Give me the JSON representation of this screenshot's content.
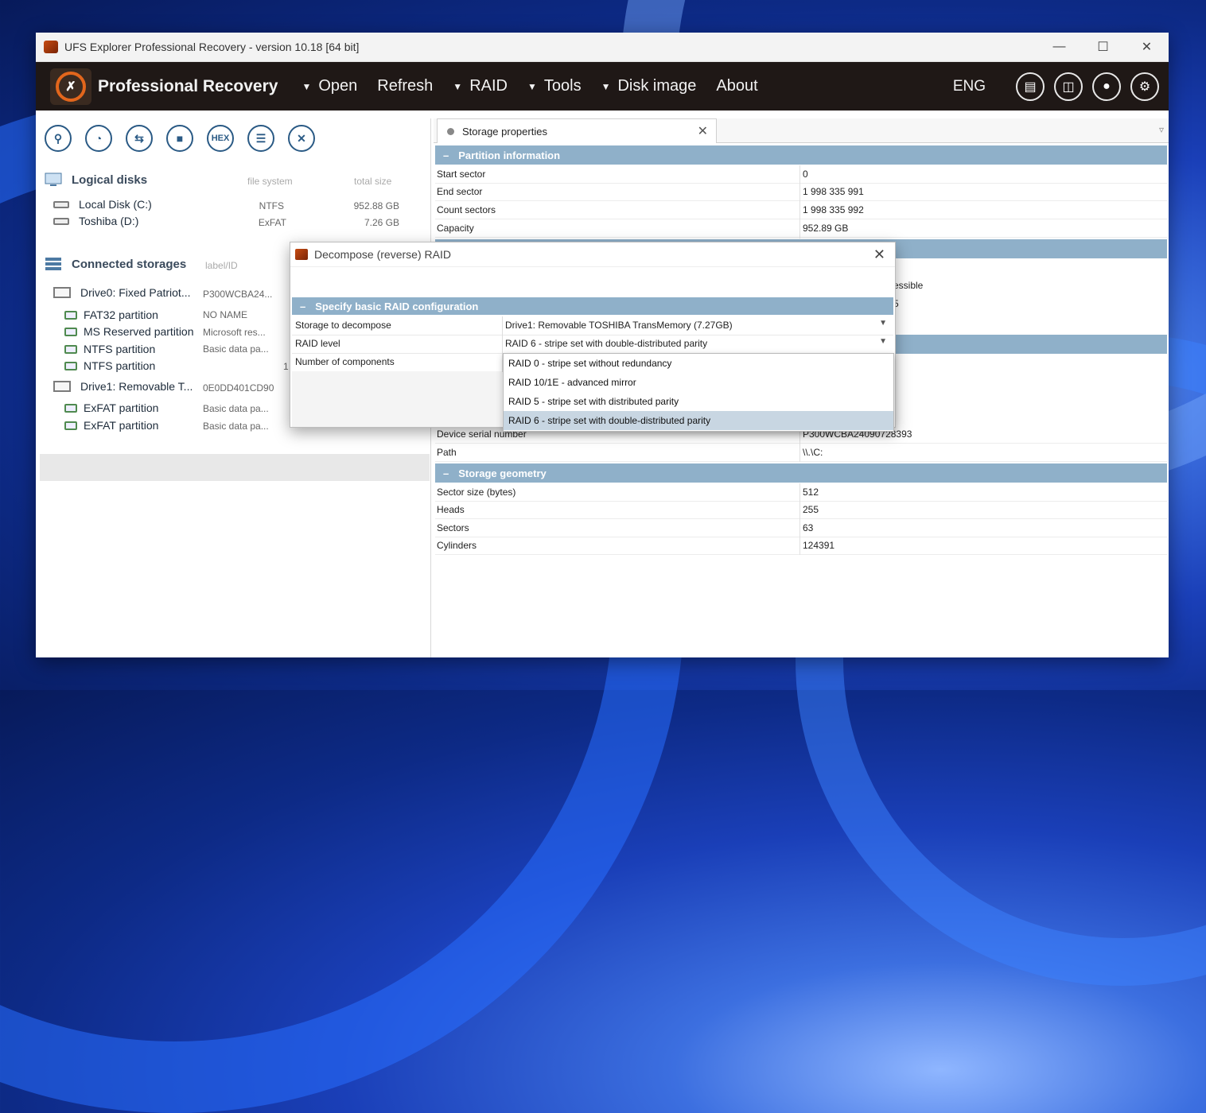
{
  "window": {
    "title": "UFS Explorer Professional Recovery - version 10.18 [64 bit]"
  },
  "appbar": {
    "app_name": "Professional Recovery",
    "menu": [
      {
        "label": "Open",
        "arrow": true
      },
      {
        "label": "Refresh",
        "arrow": false
      },
      {
        "label": "RAID",
        "arrow": true
      },
      {
        "label": "Tools",
        "arrow": true
      },
      {
        "label": "Disk image",
        "arrow": true
      },
      {
        "label": "About",
        "arrow": false
      }
    ],
    "lang": "ENG"
  },
  "toolbar": {
    "hex_label": "HEX"
  },
  "logical_disks": {
    "title": "Logical disks",
    "col_fs": "file system",
    "col_size": "total size",
    "items": [
      {
        "name": "Local Disk (C:)",
        "fs": "NTFS",
        "size": "952.88 GB"
      },
      {
        "name": "Toshiba (D:)",
        "fs": "ExFAT",
        "size": "7.26 GB"
      }
    ]
  },
  "connected": {
    "title": "Connected storages",
    "col_label": "label/ID",
    "drive0": {
      "name": "Drive0: Fixed Patriot...",
      "id": "P300WCBA24..."
    },
    "drive0_parts": [
      {
        "name": "FAT32 partition",
        "label": "NO NAME"
      },
      {
        "name": "MS Reserved partition",
        "label": "Microsoft res..."
      },
      {
        "name": "NTFS partition",
        "label": "Basic data pa..."
      },
      {
        "name": "NTFS partition",
        "label": "1"
      }
    ],
    "drive1": {
      "name": "Drive1: Removable T...",
      "id": "0E0DD401CD90"
    },
    "drive1_parts": [
      {
        "name": "ExFAT partition",
        "label": "Basic data pa..."
      },
      {
        "name": "ExFAT partition",
        "label": "Basic data pa..."
      }
    ]
  },
  "tab": {
    "label": "Storage properties"
  },
  "partition_info": {
    "title": "Partition information",
    "rows": [
      {
        "k": "Start sector",
        "v": "0"
      },
      {
        "k": "End sector",
        "v": "1 998 335 991"
      },
      {
        "k": "Count sectors",
        "v": "1 998 335 992"
      },
      {
        "k": "Capacity",
        "v": "952.89 GB"
      }
    ]
  },
  "hidden_fragments": {
    "a": "essible",
    "b": "5"
  },
  "device_rows": [
    {
      "k": "Device serial number",
      "v": "P300WCBA24090728393"
    },
    {
      "k": "Path",
      "v": "\\\\.\\C:"
    }
  ],
  "geometry": {
    "title": "Storage geometry",
    "rows": [
      {
        "k": "Sector size (bytes)",
        "v": "512"
      },
      {
        "k": "Heads",
        "v": "255"
      },
      {
        "k": "Sectors",
        "v": "63"
      },
      {
        "k": "Cylinders",
        "v": "124391"
      }
    ]
  },
  "dialog": {
    "title": "Decompose (reverse) RAID",
    "section": "Specify basic RAID configuration",
    "rows": [
      {
        "k": "Storage to decompose",
        "v": "Drive1: Removable TOSHIBA TransMemory (7.27GB)"
      },
      {
        "k": "RAID level",
        "v": "RAID 6 - stripe set with double-distributed parity"
      },
      {
        "k": "Number of components",
        "v": ""
      }
    ],
    "options": [
      "RAID 0 - stripe set without redundancy",
      "RAID 10/1E - advanced mirror",
      "RAID 5 - stripe set with distributed parity",
      "RAID 6 - stripe set with double-distributed parity"
    ],
    "selected_index": 3
  },
  "colors": {
    "band": "#8fb0c9",
    "appbar": "#1f1816",
    "accent": "#e2661c"
  }
}
